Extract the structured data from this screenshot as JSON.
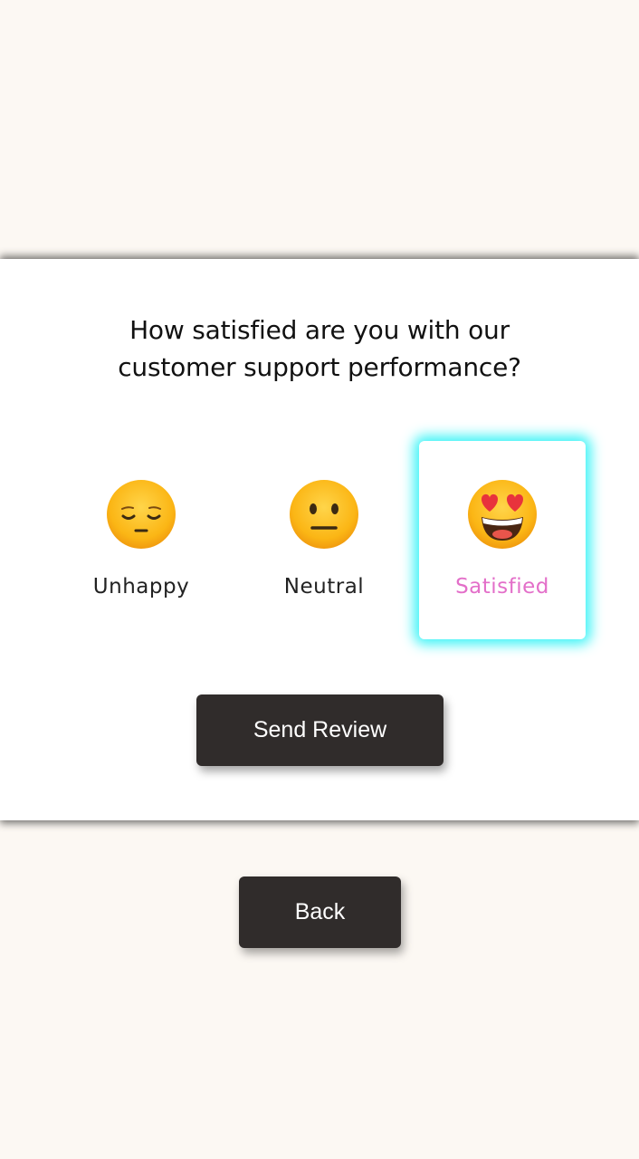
{
  "survey": {
    "question_line1": "How satisfied are you with our",
    "question_line2": "customer support performance?",
    "selected_color": "#e36fc9",
    "highlight_color": "#3ff4f7",
    "options": [
      {
        "label": "Unhappy",
        "icon": "pensive-face-icon",
        "selected": false
      },
      {
        "label": "Neutral",
        "icon": "neutral-face-icon",
        "selected": false
      },
      {
        "label": "Satisfied",
        "icon": "heart-eyes-face-icon",
        "selected": true
      }
    ],
    "send_label": "Send Review"
  },
  "footer": {
    "back_label": "Back"
  }
}
